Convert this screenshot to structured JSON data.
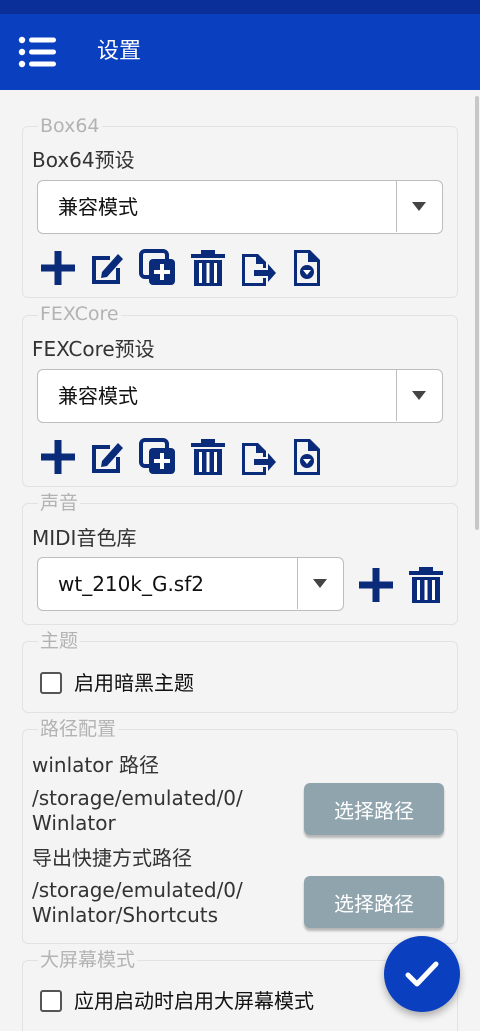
{
  "appbar": {
    "title": "设置"
  },
  "box64": {
    "legend": "Box64",
    "preset_label": "Box64预设",
    "preset_value": "兼容模式"
  },
  "fexcore": {
    "legend": "FEXCore",
    "preset_label": "FEXCore预设",
    "preset_value": "兼容模式"
  },
  "sound": {
    "legend": "声音",
    "midi_label": "MIDI音色库",
    "midi_value": "wt_210k_G.sf2"
  },
  "theme": {
    "legend": "主题",
    "dark_theme_label": "启用暗黑主题"
  },
  "paths": {
    "legend": "路径配置",
    "winlator_label": "winlator 路径",
    "winlator_path_line1": "/storage/emulated/0/",
    "winlator_path_line2": "Winlator",
    "select_button": "选择路径",
    "shortcut_label": "导出快捷方式路径",
    "shortcut_path_line1": "/storage/emulated/0/",
    "shortcut_path_line2": "Winlator/Shortcuts",
    "select_button2": "选择路径"
  },
  "bigscreen": {
    "legend": "大屏幕模式",
    "checkbox_label": "应用启动时启用大屏幕模式"
  },
  "colors": {
    "primary": "#0a3fbf",
    "icon": "#0a2a7a",
    "button_gray": "#90a4ae"
  },
  "icons": [
    "menu-icon",
    "plus-icon",
    "edit-icon",
    "duplicate-icon",
    "trash-icon",
    "export-icon",
    "import-icon",
    "check-icon"
  ]
}
